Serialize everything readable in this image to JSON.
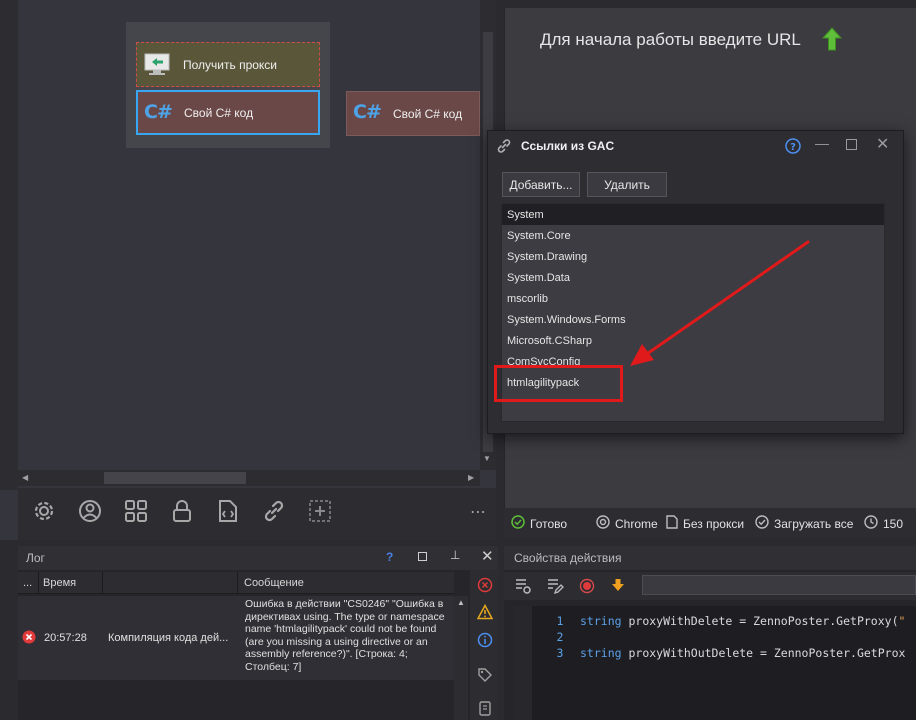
{
  "canvas": {
    "nodes": [
      {
        "label": "Получить прокси"
      },
      {
        "label": "Свой C# код"
      },
      {
        "label": "Свой C# код"
      }
    ],
    "cs_glyph": "C#"
  },
  "toolbar": {
    "icons": [
      "gear-icon",
      "user-icon",
      "grid-icon",
      "lock-icon",
      "file-code-icon",
      "link-icon",
      "add-box-icon"
    ],
    "more": "⋯"
  },
  "browser": {
    "hint": "Для начала работы введите URL",
    "status": {
      "ready": "Готово",
      "browser": "Chrome",
      "proxy": "Без прокси",
      "load": "Загружать все",
      "timer": "150"
    }
  },
  "gac_dialog": {
    "title": "Ссылки из GAC",
    "add_label": "Добавить...",
    "delete_label": "Удалить",
    "items": [
      "System",
      "System.Core",
      "System.Drawing",
      "System.Data",
      "mscorlib",
      "System.Windows.Forms",
      "Microsoft.CSharp",
      "ComSvcConfig",
      "htmlagilitypack"
    ]
  },
  "log": {
    "title": "Лог",
    "help": "?",
    "columns": {
      "dots": "...",
      "time": "Время",
      "message": "Сообщение"
    },
    "rows": [
      {
        "time": "20:57:28",
        "action": "Компиляция кода дей...",
        "message": "Ошибка в действии \"CS0246\" \"Ошибка в директивах using. The type or namespace name 'htmlagilitypack' could not be found (are you missing a using directive or an assembly reference?)\". [Строка: 4; Столбец: 7]"
      }
    ]
  },
  "properties": {
    "title": "Свойства действия",
    "code": [
      {
        "num": "1",
        "kw": "string",
        "text": " proxyWithDelete = ZennoPoster.GetProxy(",
        "str": "\""
      },
      {
        "num": "2",
        "kw": "",
        "text": "",
        "str": ""
      },
      {
        "num": "3",
        "kw": "string",
        "text": " proxyWithOutDelete = ZennoPoster.GetProx",
        "str": ""
      }
    ]
  },
  "colors": {
    "accent": "#38a6f0",
    "error": "#e01a1a",
    "arrow": "#5fbf3a"
  }
}
